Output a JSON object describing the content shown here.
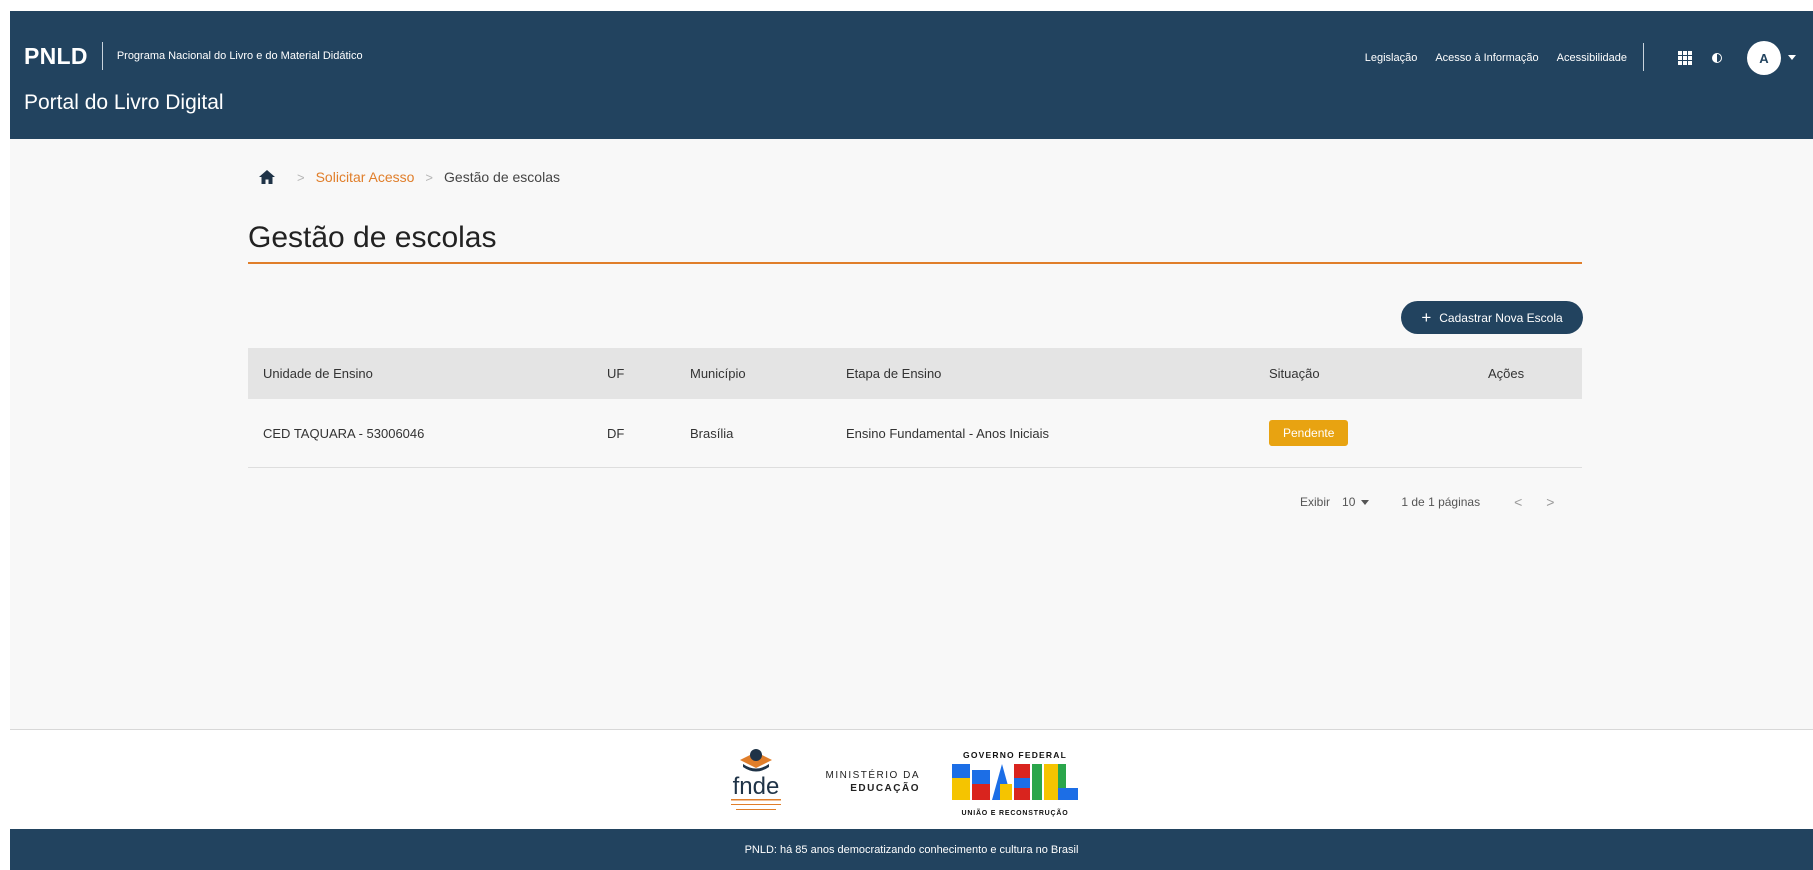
{
  "header": {
    "brand": "PNLD",
    "brand_subtitle": "Programa Nacional do Livro e do Material Didático",
    "portal_title": "Portal do Livro Digital",
    "links": [
      "Legislação",
      "Acesso à Informação",
      "Acessibilidade"
    ],
    "avatar_initial": "A",
    "icons": [
      "apps-grid-icon",
      "contrast-icon",
      "chevron-down-icon"
    ]
  },
  "breadcrumb": {
    "home_icon": "home-icon",
    "separator": ">",
    "items": [
      "Solicitar Acesso",
      "Gestão de escolas"
    ]
  },
  "page": {
    "title": "Gestão de escolas",
    "add_button_label": "Cadastrar Nova Escola",
    "add_button_icon": "plus-icon"
  },
  "table": {
    "columns": [
      "Unidade de Ensino",
      "UF",
      "Município",
      "Etapa de Ensino",
      "Situação",
      "Ações"
    ],
    "rows": [
      {
        "unidade": "CED TAQUARA - 53006046",
        "uf": "DF",
        "municipio": "Brasília",
        "etapa": "Ensino Fundamental - Anos Iniciais",
        "situacao": "Pendente"
      }
    ]
  },
  "pagination": {
    "label": "Exibir",
    "page_size": "10",
    "info": "1 de 1 páginas",
    "prev": "<",
    "next": ">"
  },
  "footer": {
    "fnde_text": "fnde",
    "mec_line1": "MINISTÉRIO DA",
    "mec_line2": "EDUCAÇÃO",
    "gov_line1": "GOVERNO FEDERAL",
    "gov_word": "BRASIL",
    "gov_line2": "UNIÃO E RECONSTRUÇÃO",
    "tagline": "PNLD: há 85 anos democratizando conhecimento e cultura no Brasil"
  },
  "colors": {
    "header_bg": "#22435f",
    "accent_orange": "#e07e2a",
    "status_pending": "#e8a311",
    "table_header_bg": "#e4e4e4"
  }
}
